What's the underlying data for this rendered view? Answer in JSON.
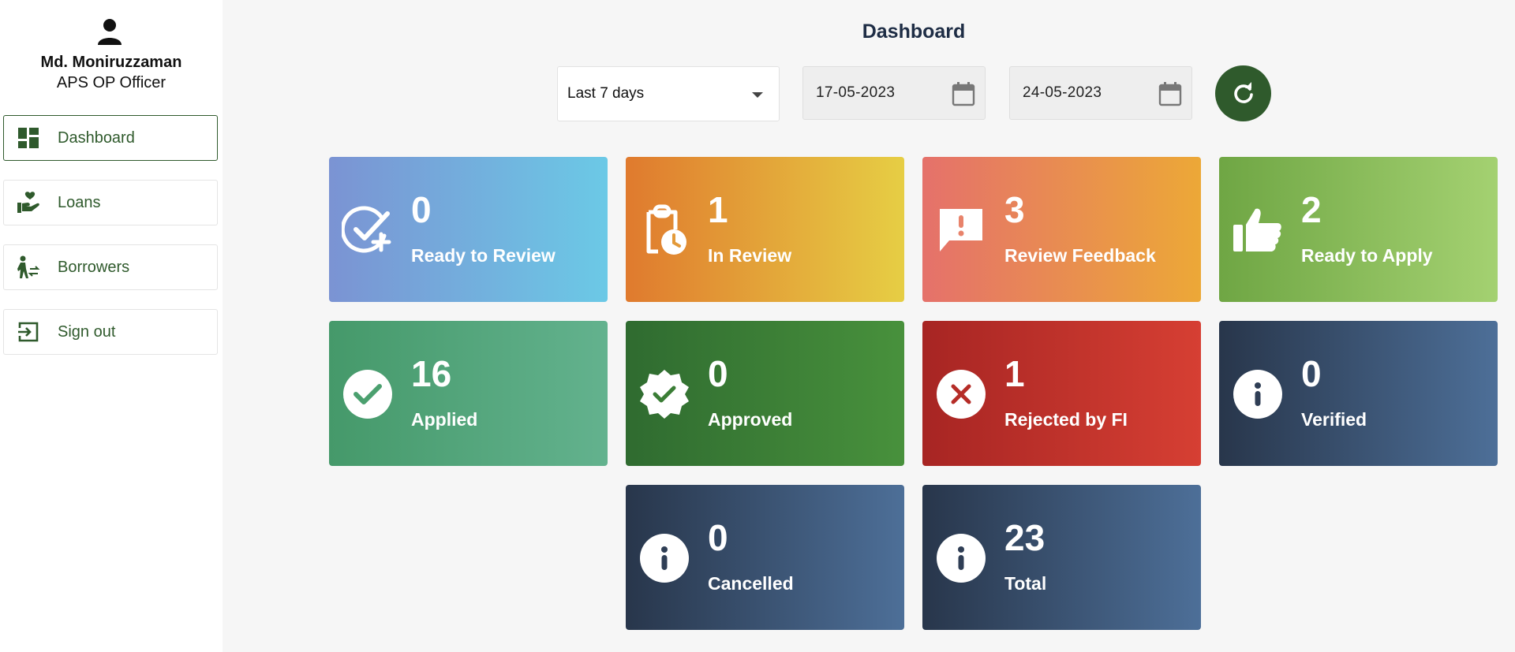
{
  "user": {
    "name": "Md. Moniruzzaman",
    "role": "APS OP Officer"
  },
  "sidebar": {
    "items": [
      {
        "label": "Dashboard",
        "icon": "dashboard-icon",
        "active": true
      },
      {
        "label": "Loans",
        "icon": "hand-heart-icon",
        "active": false
      },
      {
        "label": "Borrowers",
        "icon": "person-transfer-icon",
        "active": false
      },
      {
        "label": "Sign out",
        "icon": "sign-out-icon",
        "active": false
      }
    ]
  },
  "header": {
    "title": "Dashboard"
  },
  "filters": {
    "range": "Last 7 days",
    "start_date": "17-05-2023",
    "end_date": "24-05-2023"
  },
  "cards": [
    {
      "value": "0",
      "label": "Ready to Review",
      "icon": "check-plus-icon"
    },
    {
      "value": "1",
      "label": "In Review",
      "icon": "clipboard-clock-icon"
    },
    {
      "value": "3",
      "label": "Review Feedback",
      "icon": "chat-alert-icon"
    },
    {
      "value": "2",
      "label": "Ready to Apply",
      "icon": "thumbs-up-icon"
    },
    {
      "value": "16",
      "label": "Applied",
      "icon": "check-circle-icon"
    },
    {
      "value": "0",
      "label": "Approved",
      "icon": "badge-check-icon"
    },
    {
      "value": "1",
      "label": "Rejected by FI",
      "icon": "x-circle-icon"
    },
    {
      "value": "0",
      "label": "Verified",
      "icon": "info-circle-icon"
    },
    {
      "value": "0",
      "label": "Cancelled",
      "icon": "info-circle-icon"
    },
    {
      "value": "23",
      "label": "Total",
      "icon": "info-circle-icon"
    }
  ],
  "colors": {
    "brand_green": "#2f5a2c",
    "title": "#1e2d45"
  }
}
